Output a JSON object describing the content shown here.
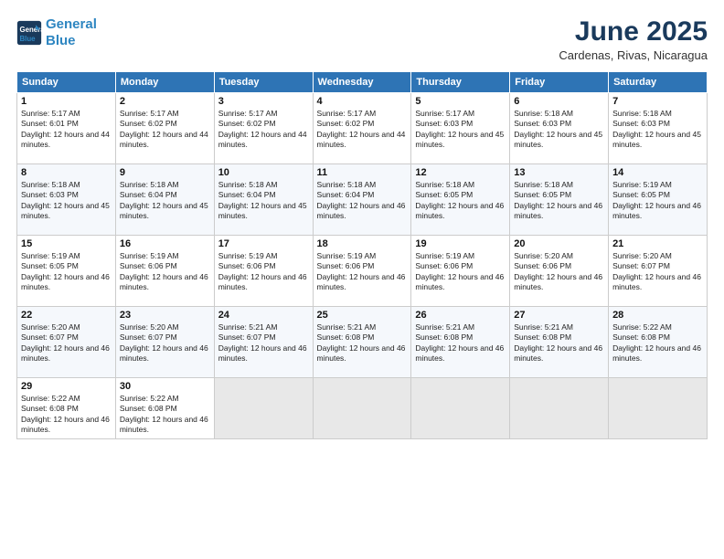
{
  "logo": {
    "line1": "General",
    "line2": "Blue"
  },
  "title": "June 2025",
  "subtitle": "Cardenas, Rivas, Nicaragua",
  "days_of_week": [
    "Sunday",
    "Monday",
    "Tuesday",
    "Wednesday",
    "Thursday",
    "Friday",
    "Saturday"
  ],
  "weeks": [
    [
      {
        "day": 1,
        "sunrise": "5:17 AM",
        "sunset": "6:01 PM",
        "daylight": "12 hours and 44 minutes"
      },
      {
        "day": 2,
        "sunrise": "5:17 AM",
        "sunset": "6:02 PM",
        "daylight": "12 hours and 44 minutes"
      },
      {
        "day": 3,
        "sunrise": "5:17 AM",
        "sunset": "6:02 PM",
        "daylight": "12 hours and 44 minutes"
      },
      {
        "day": 4,
        "sunrise": "5:17 AM",
        "sunset": "6:02 PM",
        "daylight": "12 hours and 44 minutes"
      },
      {
        "day": 5,
        "sunrise": "5:17 AM",
        "sunset": "6:03 PM",
        "daylight": "12 hours and 45 minutes"
      },
      {
        "day": 6,
        "sunrise": "5:18 AM",
        "sunset": "6:03 PM",
        "daylight": "12 hours and 45 minutes"
      },
      {
        "day": 7,
        "sunrise": "5:18 AM",
        "sunset": "6:03 PM",
        "daylight": "12 hours and 45 minutes"
      }
    ],
    [
      {
        "day": 8,
        "sunrise": "5:18 AM",
        "sunset": "6:03 PM",
        "daylight": "12 hours and 45 minutes"
      },
      {
        "day": 9,
        "sunrise": "5:18 AM",
        "sunset": "6:04 PM",
        "daylight": "12 hours and 45 minutes"
      },
      {
        "day": 10,
        "sunrise": "5:18 AM",
        "sunset": "6:04 PM",
        "daylight": "12 hours and 45 minutes"
      },
      {
        "day": 11,
        "sunrise": "5:18 AM",
        "sunset": "6:04 PM",
        "daylight": "12 hours and 46 minutes"
      },
      {
        "day": 12,
        "sunrise": "5:18 AM",
        "sunset": "6:05 PM",
        "daylight": "12 hours and 46 minutes"
      },
      {
        "day": 13,
        "sunrise": "5:18 AM",
        "sunset": "6:05 PM",
        "daylight": "12 hours and 46 minutes"
      },
      {
        "day": 14,
        "sunrise": "5:19 AM",
        "sunset": "6:05 PM",
        "daylight": "12 hours and 46 minutes"
      }
    ],
    [
      {
        "day": 15,
        "sunrise": "5:19 AM",
        "sunset": "6:05 PM",
        "daylight": "12 hours and 46 minutes"
      },
      {
        "day": 16,
        "sunrise": "5:19 AM",
        "sunset": "6:06 PM",
        "daylight": "12 hours and 46 minutes"
      },
      {
        "day": 17,
        "sunrise": "5:19 AM",
        "sunset": "6:06 PM",
        "daylight": "12 hours and 46 minutes"
      },
      {
        "day": 18,
        "sunrise": "5:19 AM",
        "sunset": "6:06 PM",
        "daylight": "12 hours and 46 minutes"
      },
      {
        "day": 19,
        "sunrise": "5:19 AM",
        "sunset": "6:06 PM",
        "daylight": "12 hours and 46 minutes"
      },
      {
        "day": 20,
        "sunrise": "5:20 AM",
        "sunset": "6:06 PM",
        "daylight": "12 hours and 46 minutes"
      },
      {
        "day": 21,
        "sunrise": "5:20 AM",
        "sunset": "6:07 PM",
        "daylight": "12 hours and 46 minutes"
      }
    ],
    [
      {
        "day": 22,
        "sunrise": "5:20 AM",
        "sunset": "6:07 PM",
        "daylight": "12 hours and 46 minutes"
      },
      {
        "day": 23,
        "sunrise": "5:20 AM",
        "sunset": "6:07 PM",
        "daylight": "12 hours and 46 minutes"
      },
      {
        "day": 24,
        "sunrise": "5:21 AM",
        "sunset": "6:07 PM",
        "daylight": "12 hours and 46 minutes"
      },
      {
        "day": 25,
        "sunrise": "5:21 AM",
        "sunset": "6:08 PM",
        "daylight": "12 hours and 46 minutes"
      },
      {
        "day": 26,
        "sunrise": "5:21 AM",
        "sunset": "6:08 PM",
        "daylight": "12 hours and 46 minutes"
      },
      {
        "day": 27,
        "sunrise": "5:21 AM",
        "sunset": "6:08 PM",
        "daylight": "12 hours and 46 minutes"
      },
      {
        "day": 28,
        "sunrise": "5:22 AM",
        "sunset": "6:08 PM",
        "daylight": "12 hours and 46 minutes"
      }
    ],
    [
      {
        "day": 29,
        "sunrise": "5:22 AM",
        "sunset": "6:08 PM",
        "daylight": "12 hours and 46 minutes"
      },
      {
        "day": 30,
        "sunrise": "5:22 AM",
        "sunset": "6:08 PM",
        "daylight": "12 hours and 46 minutes"
      },
      null,
      null,
      null,
      null,
      null
    ]
  ]
}
